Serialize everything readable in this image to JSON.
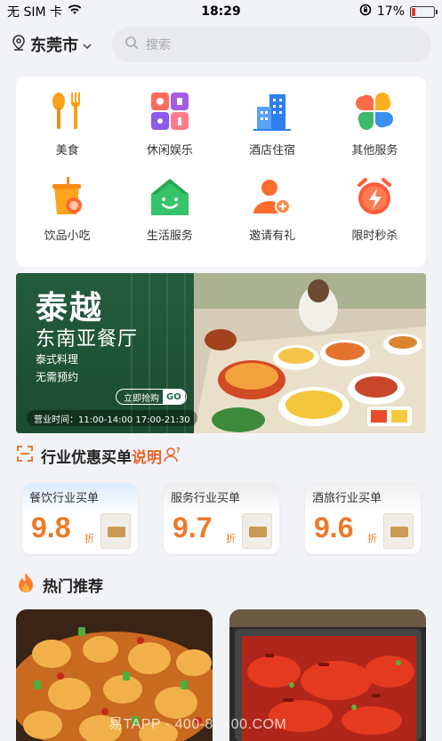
{
  "status_bar": {
    "carrier": "无 SIM 卡",
    "time": "18:29",
    "battery": "17%",
    "battery_level": 0.17
  },
  "header": {
    "city": "东莞市",
    "search_placeholder": "搜索"
  },
  "categories": [
    {
      "label": "美食",
      "icon": "fork-spoon-icon"
    },
    {
      "label": "休闲娱乐",
      "icon": "entertainment-icon"
    },
    {
      "label": "酒店住宿",
      "icon": "hotel-icon"
    },
    {
      "label": "其他服务",
      "icon": "petals-icon"
    },
    {
      "label": "饮品小吃",
      "icon": "drink-cup-icon"
    },
    {
      "label": "生活服务",
      "icon": "house-smile-icon"
    },
    {
      "label": "邀请有礼",
      "icon": "invite-user-icon"
    },
    {
      "label": "限时秒杀",
      "icon": "alarm-flash-icon"
    }
  ],
  "banner": {
    "title": "泰越",
    "subtitle": "东南亚餐厅",
    "line1": "泰式料理",
    "line2": "无需预约",
    "cta": "立即抢购",
    "cta_go": "GO",
    "hours": "营业时间：11:00-14:00 17:00-21:30"
  },
  "deals_section": {
    "title": "行业优惠买单",
    "link": "说明",
    "items": [
      {
        "label": "餐饮行业买单",
        "value": "9.8",
        "unit": "折"
      },
      {
        "label": "服务行业买单",
        "value": "9.7",
        "unit": "折"
      },
      {
        "label": "酒旅行业买单",
        "value": "9.6",
        "unit": "折"
      }
    ]
  },
  "hot_section": {
    "title": "热门推荐"
  },
  "watermark": "易TAPP · 400-8... 00.COM",
  "colors": {
    "accent": "#ec7a2b",
    "link": "#e8632d",
    "background": "#f2f3f7"
  }
}
